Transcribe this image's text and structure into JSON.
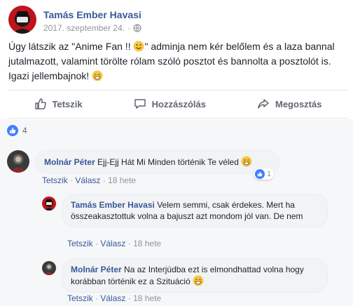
{
  "post": {
    "author": "Tamás Ember Havasi",
    "timestamp": "2017. szeptember 24.",
    "body": {
      "seg1": "Úgy látszik az \"Anime Fan !! ",
      "seg2": "\" adminja nem kér belőlem és a laza bannal jutalmazott, valamint törölte rólam szóló posztot és bannolta a posztolót is. Igazi jellembajnok! "
    }
  },
  "actions": {
    "like": "Tetszik",
    "comment": "Hozzászólás",
    "share": "Megosztás"
  },
  "reactions": {
    "count": "4"
  },
  "comments": [
    {
      "author": "Molnár Péter",
      "text": "Ejj-Ejj Hát Mi Minden történik Te véled ",
      "like": "Tetszik",
      "reply": "Válasz",
      "time": "18 hete",
      "reaction_count": "1"
    },
    {
      "author": "Tamás Ember Havasi",
      "text": "Velem semmi, csak érdekes. Mert ha összeakasztottuk volna a bajuszt azt mondom jól van. De nem",
      "like": "Tetszik",
      "reply": "Válasz",
      "time": "18 hete"
    },
    {
      "author": "Molnár Péter",
      "text": "Na az Interjúdba ezt is elmondhattad volna hogy korábban történik ez a Szituáció ",
      "like": "Tetszik",
      "reply": "Válasz",
      "time": "18 hete"
    }
  ],
  "colors": {
    "link": "#385898",
    "like_blue": "#4080ff",
    "meta_gray": "#90949c"
  }
}
